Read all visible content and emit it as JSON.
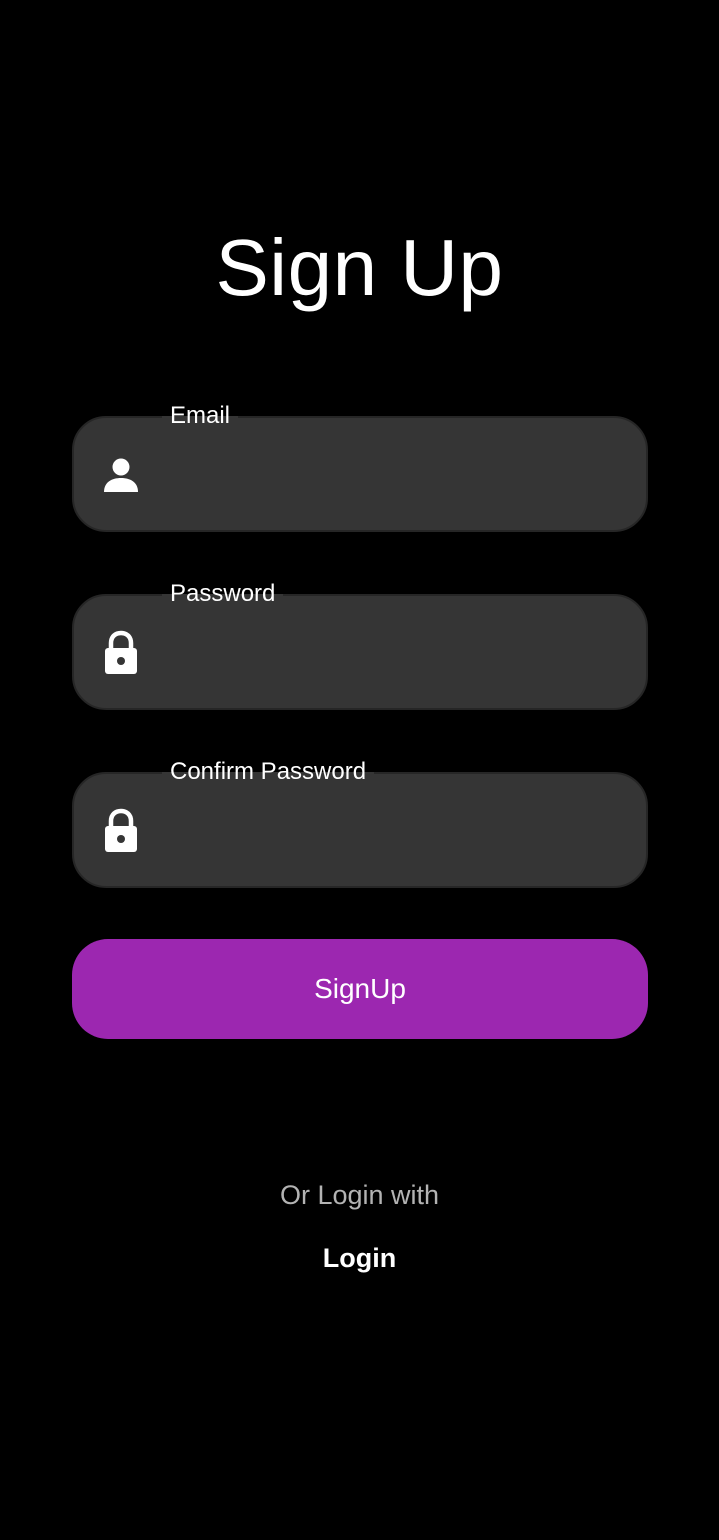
{
  "title": "Sign Up",
  "fields": [
    {
      "label": "Email",
      "icon": "person-icon",
      "value": ""
    },
    {
      "label": "Password",
      "icon": "lock-icon",
      "value": ""
    },
    {
      "label": "Confirm Password",
      "icon": "lock-icon",
      "value": ""
    }
  ],
  "signup_button_label": "SignUp",
  "alt_prompt": "Or Login with",
  "login_link_label": "Login",
  "colors": {
    "background": "#000000",
    "field_background": "#353535",
    "accent": "#9c27b0",
    "text": "#ffffff",
    "muted_text": "#b3b3b3"
  }
}
